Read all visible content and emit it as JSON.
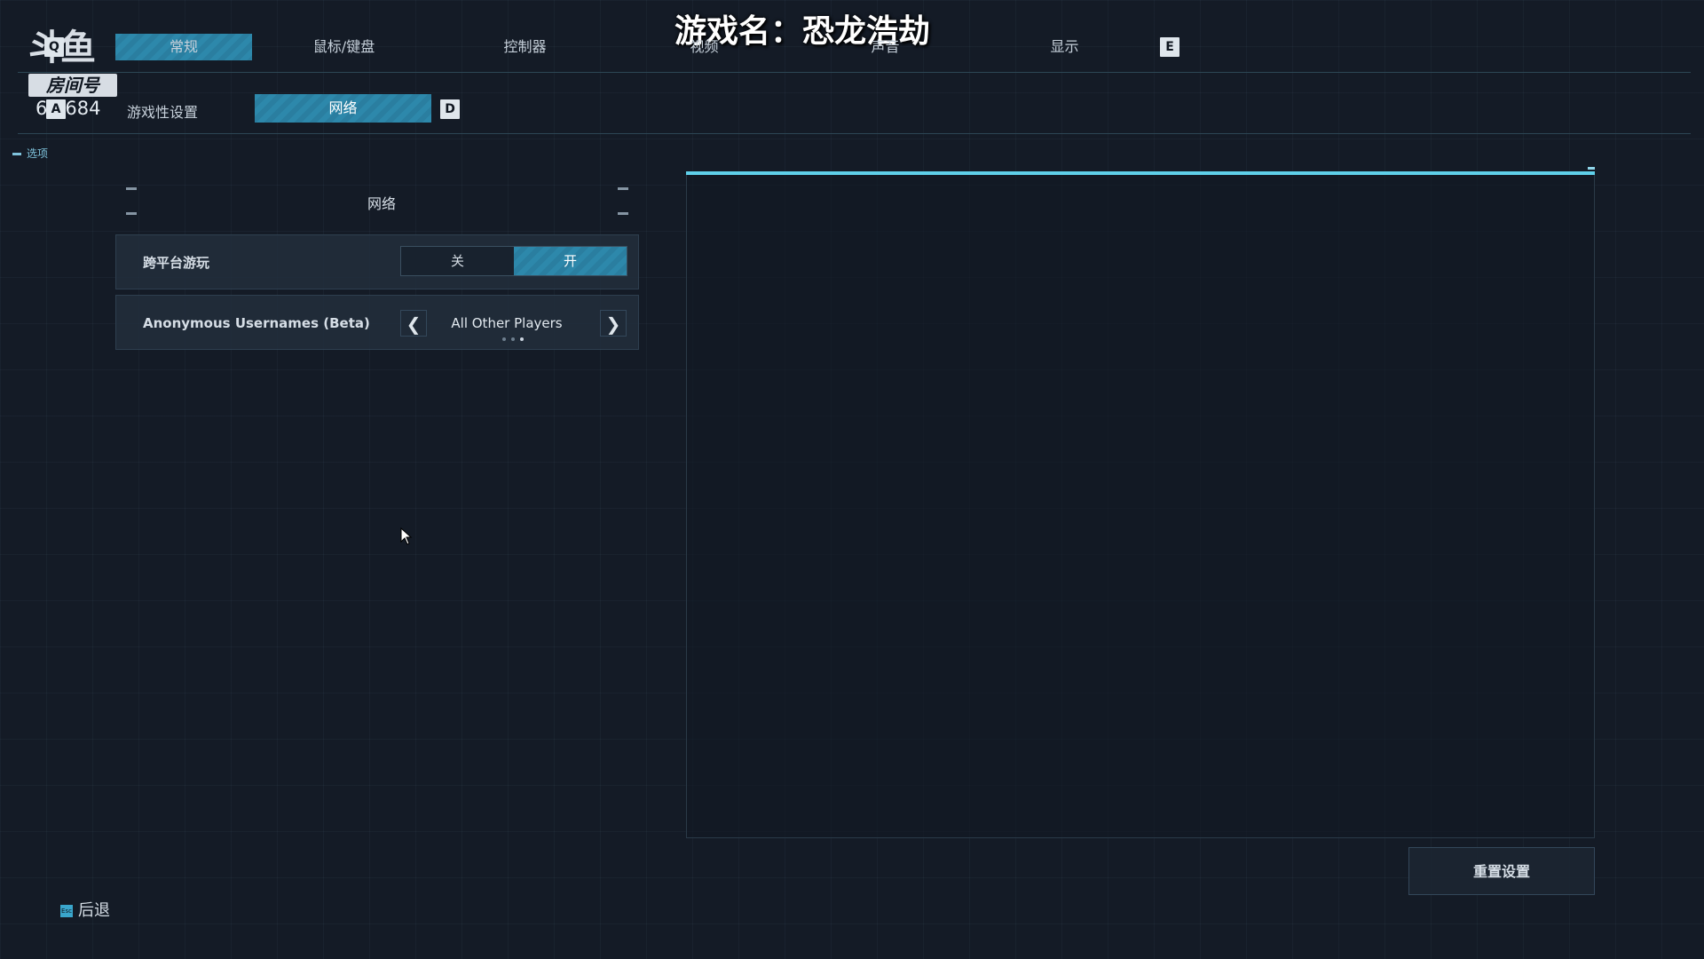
{
  "watermark": {
    "logo_text": "斗鱼",
    "room_label": "房间号",
    "room_number": "6 6684"
  },
  "overlay": {
    "game_title": "游戏名：恐龙浩劫"
  },
  "top_tabs": {
    "left_key": "Q",
    "right_key": "E",
    "items": [
      {
        "label": "常规",
        "active": true
      },
      {
        "label": "鼠标/键盘",
        "active": false
      },
      {
        "label": "控制器",
        "active": false
      },
      {
        "label": "视频",
        "active": false
      },
      {
        "label": "声音",
        "active": false
      },
      {
        "label": "显示",
        "active": false
      }
    ]
  },
  "sub_tabs": {
    "left_key": "A",
    "right_key": "D",
    "items": [
      {
        "label": "游戏性设置",
        "active": false
      },
      {
        "label": "网络",
        "active": true
      }
    ]
  },
  "options_tag": "选项",
  "section": {
    "title": "网络"
  },
  "settings": {
    "crossplay": {
      "label": "跨平台游玩",
      "off_label": "关",
      "on_label": "开",
      "value": "开"
    },
    "anon_usernames": {
      "label": "Anonymous Usernames (Beta)",
      "value": "All Other Players",
      "option_count": 3,
      "selected_index": 2
    }
  },
  "buttons": {
    "reset": "重置设置",
    "back": "后退",
    "back_key": "Esc"
  },
  "colors": {
    "accent": "#5fd0ea",
    "active_tab": "#2d88ab",
    "background": "#141b26"
  },
  "icons": {
    "prev": "chevron-left-icon",
    "next": "chevron-right-icon",
    "cursor": "mouse-cursor-icon"
  }
}
